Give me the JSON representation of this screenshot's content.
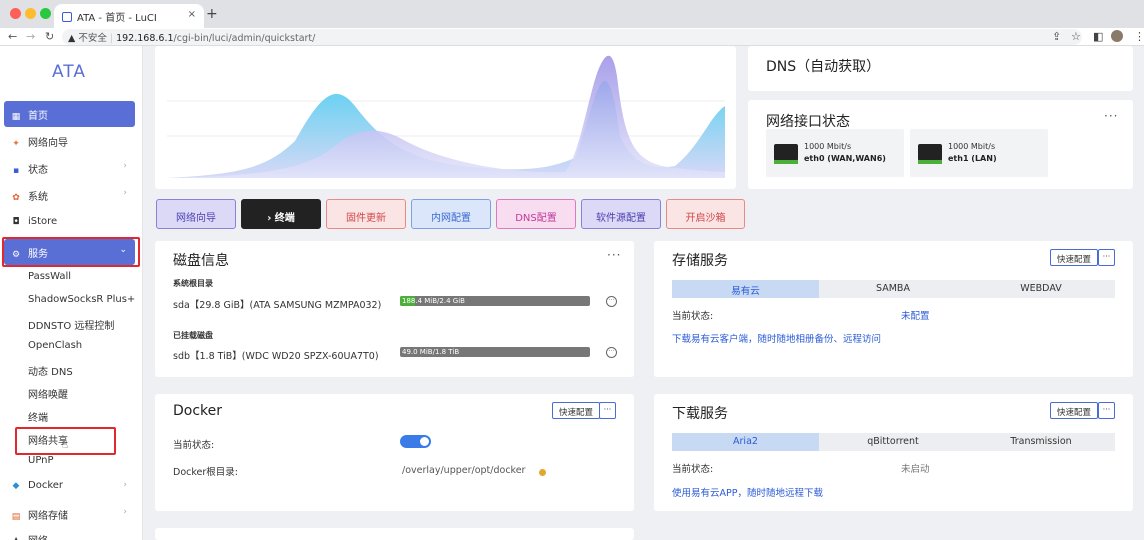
{
  "browser": {
    "tab_title": "ATA - 首页 - LuCI",
    "tab_close": "×",
    "new_tab": "+",
    "insecure_label": "不安全",
    "url_host": "192.168.6.1",
    "url_path": "/cgi-bin/luci/admin/quickstart/",
    "traffic_lights": [
      "#fe5f57",
      "#febc2e",
      "#28c840"
    ]
  },
  "sidebar": {
    "brand": "ATA",
    "items": [
      {
        "label": "首页",
        "icon": "home-icon",
        "glyph": "▦"
      },
      {
        "label": "网络向导",
        "icon": "network-wizard-icon",
        "glyph": "✦"
      },
      {
        "label": "状态",
        "icon": "status-icon",
        "glyph": "▪"
      },
      {
        "label": "系统",
        "icon": "system-gear-icon",
        "glyph": "✿"
      },
      {
        "label": "iStore",
        "icon": "store-icon",
        "glyph": "◘"
      },
      {
        "label": "服务",
        "icon": "services-icon",
        "glyph": "⚙"
      }
    ],
    "services_sub": [
      "PassWall",
      "ShadowSocksR Plus+",
      "DDNSTO 远程控制",
      "OpenClash",
      "动态 DNS",
      "网络唤醒",
      "终端",
      "网络共享",
      "UPnP"
    ],
    "bottom": [
      {
        "label": "Docker",
        "icon": "docker-icon",
        "glyph": "◆"
      },
      {
        "label": "网络存储",
        "icon": "storage-icon",
        "glyph": "▤"
      },
      {
        "label": "网络",
        "icon": "network-icon",
        "glyph": "♟"
      }
    ],
    "accent": "#5a6fd6",
    "highlight": "#e0282e"
  },
  "dns": {
    "title": "DNS（自动获取）"
  },
  "net_status": {
    "title": "网络接口状态",
    "ports": [
      {
        "speed": "1000 Mbit/s",
        "name": "eth0 (WAN,WAN6)"
      },
      {
        "speed": "1000 Mbit/s",
        "name": "eth1 (LAN)"
      }
    ]
  },
  "quick_buttons": [
    "网络向导",
    "终端",
    "固件更新",
    "内网配置",
    "DNS配置",
    "软件源配置",
    "开启沙箱"
  ],
  "disk": {
    "title": "磁盘信息",
    "system_label": "系统根目录",
    "system_disk": "sda【29.8 GiB】(ATA SAMSUNG MZMPA032)",
    "system_usage": "188.4 MiB/2.4 GiB",
    "system_fraction": 0.08,
    "mounted_label": "已挂载磁盘",
    "mounted_disk": "sdb【1.8 TiB】(WDC WD20 SPZX-60UA7T0)",
    "mounted_usage": "49.0 MiB/1.8 TiB",
    "mounted_fraction": 0.0
  },
  "storage": {
    "title": "存储服务",
    "quick_config": "快速配置",
    "tabs": [
      "易有云",
      "SAMBA",
      "WEBDAV"
    ],
    "state_label": "当前状态:",
    "state_value": "未配置",
    "link": "下载易有云客户端，随时随地相册备份、远程访问"
  },
  "docker": {
    "title": "Docker",
    "quick_config": "快速配置",
    "state_label": "当前状态:",
    "enabled": true,
    "root_label": "Docker根目录:",
    "root_value": "/overlay/upper/opt/docker"
  },
  "download": {
    "title": "下载服务",
    "quick_config": "快速配置",
    "tabs": [
      "Aria2",
      "qBittorrent",
      "Transmission"
    ],
    "state_label": "当前状态:",
    "state_value": "未启动",
    "link": "使用易有云APP，随时随地远程下载"
  }
}
